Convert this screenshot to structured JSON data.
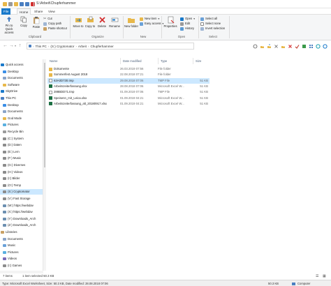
{
  "window": {
    "title": "S:\\Arbeit\\Chupferhammer"
  },
  "ribbon_tabs": [
    {
      "label": "File"
    },
    {
      "label": "Home"
    },
    {
      "label": "Share"
    },
    {
      "label": "View"
    }
  ],
  "ribbon": {
    "clipboard": {
      "group_label": "Clipboard",
      "pin_label": "Pin to Quick access",
      "copy_label": "Copy",
      "paste_label": "Paste",
      "cut_label": "Cut",
      "copy_path_label": "Copy path",
      "paste_shortcut_label": "Paste shortcut"
    },
    "organize": {
      "group_label": "Organize",
      "move_to_label": "Move to",
      "copy_to_label": "Copy to",
      "delete_label": "Delete",
      "rename_label": "Rename"
    },
    "new": {
      "group_label": "New",
      "new_folder_label": "New folder",
      "new_item_label": "New item",
      "easy_access_label": "Easy access"
    },
    "open": {
      "group_label": "Open",
      "properties_label": "Properties",
      "open_label": "Open",
      "edit_label": "Edit",
      "history_label": "History"
    },
    "select": {
      "group_label": "Select",
      "select_all_label": "Select all",
      "select_none_label": "Select none",
      "invert_selection_label": "Invert selection"
    }
  },
  "address": {
    "segments": [
      "This PC",
      "(S:) Cryptomator",
      "Arbeit",
      "Chupferhammer"
    ]
  },
  "columns": {
    "name": "Name",
    "date": "Date modified",
    "type": "Type",
    "size": "Size"
  },
  "files": [
    {
      "name": "Dokumente",
      "date": "26.03.2019 07:56",
      "type": "File folder",
      "size": "",
      "kind": "folder"
    },
    {
      "name": "Sommerfest August 2018",
      "date": "22.08.2018 07:21",
      "type": "File folder",
      "size": "",
      "kind": "folder"
    },
    {
      "name": "63A0D730.tmp",
      "date": "29.08.2018 07:06",
      "type": "TMP File",
      "size": "51 KB",
      "kind": "tmp"
    },
    {
      "name": "Arbeitszeiterfassung.xlsx",
      "date": "28.08.2018 07:06",
      "type": "Microsoft Excel W...",
      "size": "51 KB",
      "kind": "excel"
    },
    {
      "name": "288BDD71.tmp",
      "date": "01.09.2019 07:06",
      "type": "TMP File",
      "size": "51 KB",
      "kind": "tmp"
    },
    {
      "name": "Speisenn_mit_Leica.xlsx",
      "date": "01.09.2019 04:21",
      "type": "Microsoft Excel W...",
      "size": "51 KB",
      "kind": "excel"
    },
    {
      "name": "Arbeitszeiterfassung_alt_20180917.xlsx",
      "date": "01.09.2019 04:21",
      "type": "Microsoft Excel W...",
      "size": "51 KB",
      "kind": "excel"
    }
  ],
  "nav": [
    {
      "label": "Quick access",
      "kind": "star",
      "indent": 0
    },
    {
      "label": "Desktop",
      "kind": "blue",
      "indent": 1
    },
    {
      "label": "Documents",
      "kind": "doc",
      "indent": 1
    },
    {
      "label": "Software",
      "kind": "folder",
      "indent": 1
    },
    {
      "label": "SkyDrive",
      "kind": "cloud",
      "indent": 0
    },
    {
      "label": "This PC",
      "kind": "pc",
      "indent": 0
    },
    {
      "label": "Desktop",
      "kind": "blue",
      "indent": 1
    },
    {
      "label": "Documents",
      "kind": "doc",
      "indent": 1
    },
    {
      "label": "God Mode",
      "kind": "folder",
      "indent": 1
    },
    {
      "label": "Pictures",
      "kind": "pic",
      "indent": 1
    },
    {
      "label": "Recycle Bin",
      "kind": "bin",
      "indent": 1
    },
    {
      "label": "(C:) System",
      "kind": "drive",
      "indent": 1
    },
    {
      "label": "(D:) Daten",
      "kind": "drive",
      "indent": 1
    },
    {
      "label": "(E:) Lern",
      "kind": "drive",
      "indent": 1
    },
    {
      "label": "(F:) Music",
      "kind": "drive",
      "indent": 1
    },
    {
      "label": "(G:) Diverses",
      "kind": "drive",
      "indent": 1
    },
    {
      "label": "(H:) Videos",
      "kind": "drive",
      "indent": 1
    },
    {
      "label": "(I:) Bilder",
      "kind": "drive",
      "indent": 1
    },
    {
      "label": "(O:) Temp",
      "kind": "drive",
      "indent": 1
    },
    {
      "label": "(S:) Cryptomator",
      "kind": "drive",
      "indent": 1,
      "selected": true
    },
    {
      "label": "(V:) Fast Storage",
      "kind": "drive",
      "indent": 1
    },
    {
      "label": "(W:) https://webdav",
      "kind": "net",
      "indent": 1
    },
    {
      "label": "(X:) https://webdav",
      "kind": "net",
      "indent": 1
    },
    {
      "label": "(Y:) Downloads_Arch",
      "kind": "net",
      "indent": 1
    },
    {
      "label": "(Z:) Downloads_Arch",
      "kind": "net",
      "indent": 1
    },
    {
      "label": "Libraries",
      "kind": "lib",
      "indent": 0
    },
    {
      "label": "Documents",
      "kind": "doc",
      "indent": 1
    },
    {
      "label": "Music",
      "kind": "music",
      "indent": 1
    },
    {
      "label": "Pictures",
      "kind": "pic",
      "indent": 1
    },
    {
      "label": "Videos",
      "kind": "video",
      "indent": 1
    },
    {
      "label": "(I:) Games",
      "kind": "drive",
      "indent": 1
    }
  ],
  "status": {
    "items": "7 items",
    "selected": "1 item selected  50.3 KB"
  },
  "bottom": {
    "info": "Type: Microsoft Excel Worksheet, Size: 50.3 KB, Date modified: 28.08.2018 07:06",
    "size": "50.3 KB",
    "location": "Computer"
  },
  "colors": {
    "accent": "#1979ca",
    "selection": "#cce8ff",
    "folder": "#e8b84a",
    "excel": "#1d7044",
    "delete_red": "#d32f2f"
  }
}
